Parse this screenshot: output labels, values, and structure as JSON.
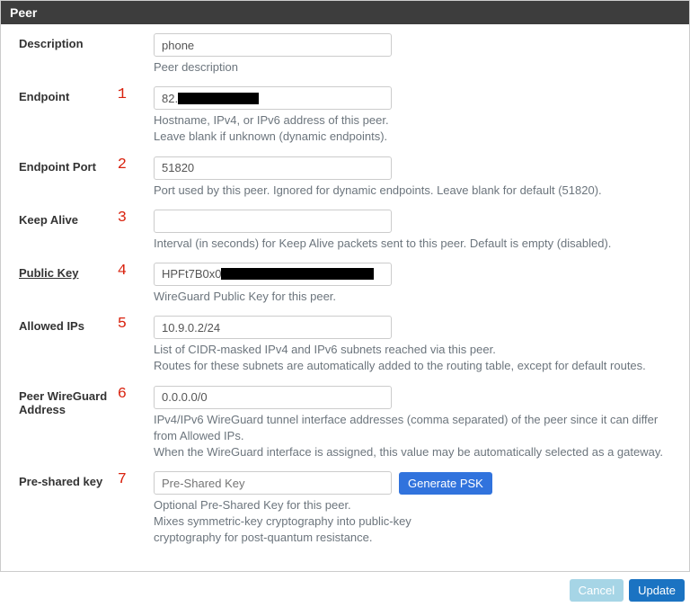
{
  "panel": {
    "title": "Peer"
  },
  "markers": {
    "m1": "1",
    "m2": "2",
    "m3": "3",
    "m4": "4",
    "m5": "5",
    "m6": "6",
    "m7": "7"
  },
  "fields": {
    "description": {
      "label": "Description",
      "value": "phone",
      "help": "Peer description"
    },
    "endpoint": {
      "label": "Endpoint",
      "value_prefix": "82.",
      "help": "Hostname, IPv4, or IPv6 address of this peer.\nLeave blank if unknown (dynamic endpoints)."
    },
    "endpoint_port": {
      "label": "Endpoint Port",
      "value": "51820",
      "help": "Port used by this peer. Ignored for dynamic endpoints. Leave blank for default (51820)."
    },
    "keep_alive": {
      "label": "Keep Alive",
      "value": "",
      "help": "Interval (in seconds) for Keep Alive packets sent to this peer. Default is empty (disabled)."
    },
    "public_key": {
      "label": "Public Key",
      "value_prefix": "HPFt7B0x0",
      "help": "WireGuard Public Key for this peer."
    },
    "allowed_ips": {
      "label": "Allowed IPs",
      "value": "10.9.0.2/24",
      "help": "List of CIDR-masked IPv4 and IPv6 subnets reached via this peer.\nRoutes for these subnets are automatically added to the routing table, except for default routes."
    },
    "peer_wg_addr": {
      "label": "Peer WireGuard Address",
      "value": "0.0.0.0/0",
      "help": "IPv4/IPv6 WireGuard tunnel interface addresses (comma separated) of the peer since it can differ from Allowed IPs.\nWhen the WireGuard interface is assigned, this value may be automatically selected as a gateway."
    },
    "psk": {
      "label": "Pre-shared key",
      "placeholder": "Pre-Shared Key",
      "button": "Generate PSK",
      "help": "Optional Pre-Shared Key for this peer.\nMixes symmetric-key cryptography into public-key cryptography for post-quantum resistance."
    }
  },
  "footer": {
    "cancel": "Cancel",
    "update": "Update"
  }
}
